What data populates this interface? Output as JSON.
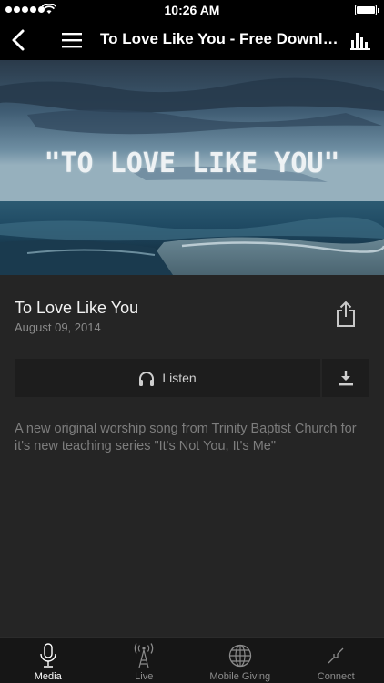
{
  "status_bar": {
    "time": "10:26 AM",
    "signal_bars": 5
  },
  "nav": {
    "title": "To Love Like You - Free Download",
    "back_icon": "chevron-left-icon",
    "menu_icon": "hamburger-icon",
    "chart_icon": "bar-chart-icon"
  },
  "hero": {
    "overlay_text": "\"TO LOVE LIKE YOU\""
  },
  "media": {
    "title": "To Love Like You",
    "date": "August 09, 2014",
    "listen_label": "Listen",
    "description": "A new original worship song from Trinity Baptist Church for it's new teaching series \"It's Not You, It's Me\""
  },
  "tabs": [
    {
      "label": "Media",
      "icon": "microphone-icon",
      "active": true
    },
    {
      "label": "Live",
      "icon": "broadcast-tower-icon",
      "active": false
    },
    {
      "label": "Mobile Giving",
      "icon": "globe-icon",
      "active": false
    },
    {
      "label": "Connect",
      "icon": "connect-arrows-icon",
      "active": false
    }
  ],
  "colors": {
    "background": "#252525",
    "bar": "#000000",
    "tab_bar": "#161616",
    "button": "#1d1d1d",
    "muted_text": "#7d7d7d"
  }
}
